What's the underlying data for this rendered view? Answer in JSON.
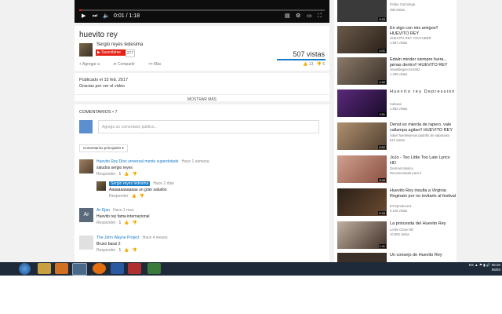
{
  "player": {
    "time": "0:01 / 1:18",
    "progress": 0.01
  },
  "video": {
    "title": "huevito rey",
    "channel": "Sergio reyes ledesima",
    "subscribe_label": "Suscribirse",
    "subscriber_count": "277",
    "views": "507 vistas",
    "actions": [
      "Agregar a",
      "Compartir",
      "Más"
    ],
    "likes": "13",
    "dislikes": "6"
  },
  "description": {
    "published": "Publicado el 15 feb. 2017",
    "text": "Gracias por ver el video",
    "show_more": "MOSTRAR MÁS"
  },
  "comments": {
    "header": "COMENTARIOS • 7",
    "placeholder": "Agrega un comentario público...",
    "sort_label": "Comentarios principales",
    "items": [
      {
        "author": "Huevito Rey Dios universal mente superdotado",
        "time": "Hace 1 semana",
        "text": "saludos sergio reyes",
        "reply": "Responder",
        "likes": "1"
      },
      {
        "author": "Sergio reyes ledesma",
        "time": "Hace 2 días",
        "text": "Aaaaaaaaaaaaa un gran saludos",
        "reply": "Responder",
        "likes": ""
      },
      {
        "author": "Ar-Djan",
        "time": "Hace 1 mes",
        "text": "Huevito rey fama internacional",
        "reply": "Responder",
        "likes": "1",
        "initials": "Ar"
      },
      {
        "author": "The John Wayne Project",
        "time": "Hace 4 meses",
        "text": "Bruno bassi 2",
        "reply": "Responder",
        "likes": "1"
      }
    ]
  },
  "sidebar": [
    {
      "title": "",
      "channel": "Felipe Carmirega",
      "views": "496 vistas",
      "duration": "0:33"
    },
    {
      "title": "En stgo con mis amigos!! HUEVITO REY",
      "channel": "HUEVITO REY YOUTUBER",
      "views": "1.957 vistas",
      "duration": "1:01"
    },
    {
      "title": "Edwin minder siempre fuera... jamas dentro!! HUEVITO REY",
      "channel": "Jeanldiegoccen1582",
      "views": "1.335 vistas",
      "duration": "1:32"
    },
    {
      "title": "Huevito rey Depression",
      "channel": "Kaloaeo",
      "views": "1.882 vistas",
      "duration": "1:51"
    },
    {
      "title": "Denst es mierda de rapero. vale callampa agilao!! HUEVITO REY",
      "channel": "rafael fuentesjesus padolfo de valparaiso",
      "views": "512 vistas",
      "duration": "0:52"
    },
    {
      "title": "JoJo - Too Little Too Late Lyrics HD",
      "channel": "German Música",
      "views": "Recomendado para ti",
      "duration": "3:49"
    },
    {
      "title": "Huevito Rey insulta a Virginia Reginato por no invitarlo al festival",
      "channel": "ETreproducer1",
      "views": "6.120 vistas",
      "duration": "0:33"
    },
    {
      "title": "La princesita del Huevito Rey",
      "channel": "Leslie Chow HD",
      "views": "10.805 vistas",
      "duration": "1:11"
    },
    {
      "title": "Un consejo de Huevito Rey",
      "channel": "",
      "views": "",
      "duration": ""
    }
  ],
  "taskbar": {
    "lang": "ES",
    "time": "05:20",
    "date": "06/03"
  }
}
